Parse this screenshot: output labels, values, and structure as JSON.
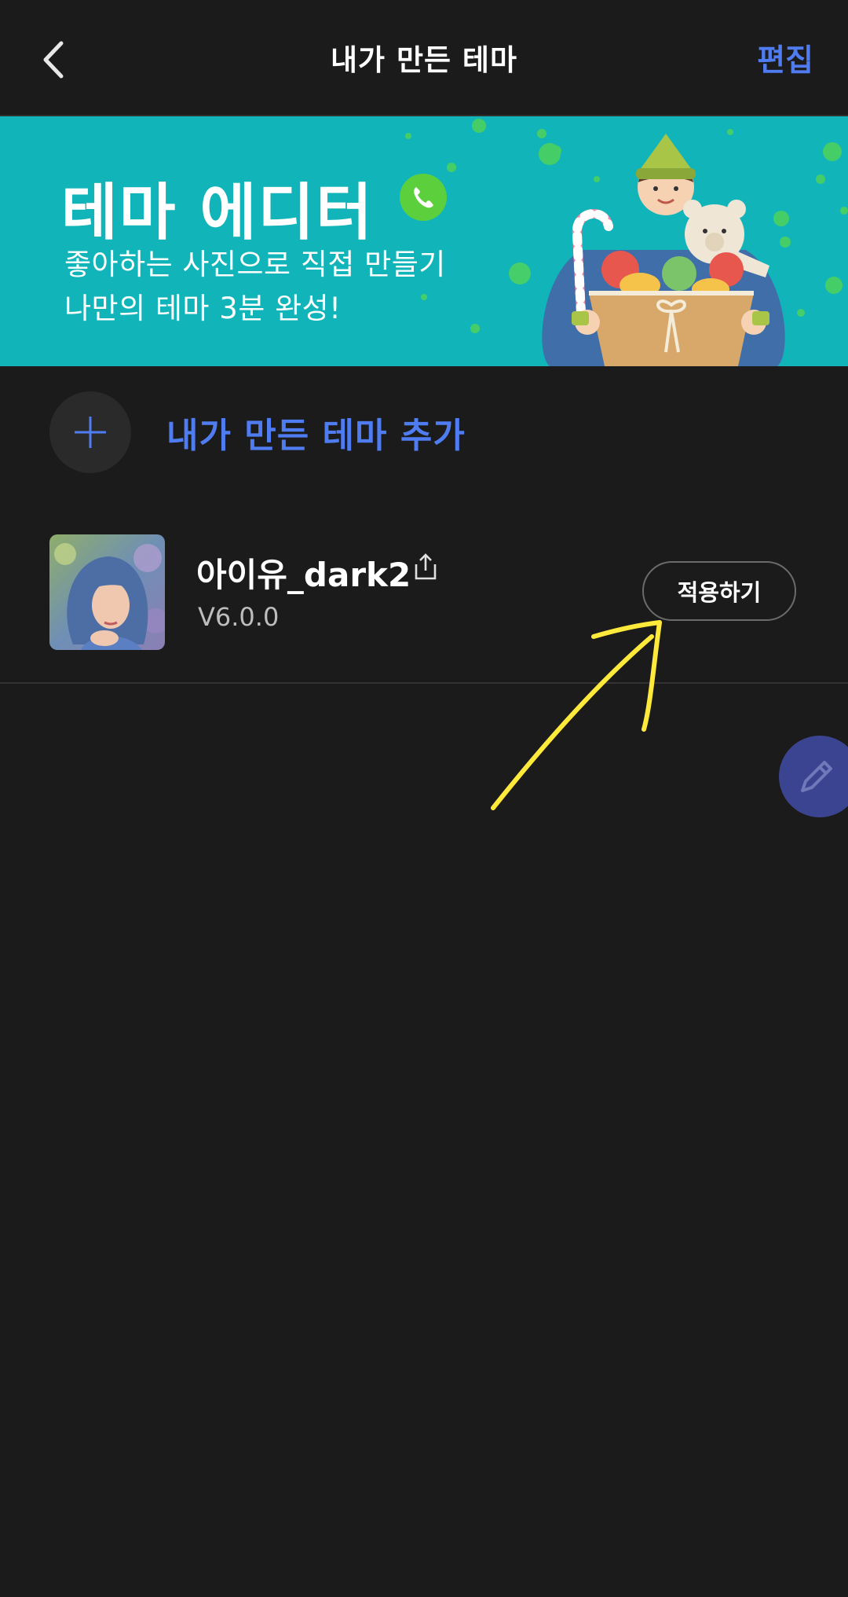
{
  "header": {
    "title": "내가 만든 테마",
    "edit_label": "편집"
  },
  "banner": {
    "title": "테마 에디터",
    "subtitle_line1": "좋아하는 사진으로 직접 만들기",
    "subtitle_line2": "나만의 테마 3분 완성!"
  },
  "add_theme": {
    "label": "내가 만든 테마 추가"
  },
  "themes": [
    {
      "name": "아이유_dark2",
      "version": "V6.0.0",
      "apply_label": "적용하기"
    }
  ],
  "colors": {
    "background": "#1b1b1b",
    "accent": "#4f7cf0",
    "banner": "#11b5b9",
    "annotation": "#ffe93b",
    "fab": "#3a4490"
  },
  "icons": {
    "back": "chevron-left-icon",
    "banner_phone": "phone-icon",
    "add": "plus-icon",
    "share": "share-icon",
    "fab": "pencil-icon"
  }
}
